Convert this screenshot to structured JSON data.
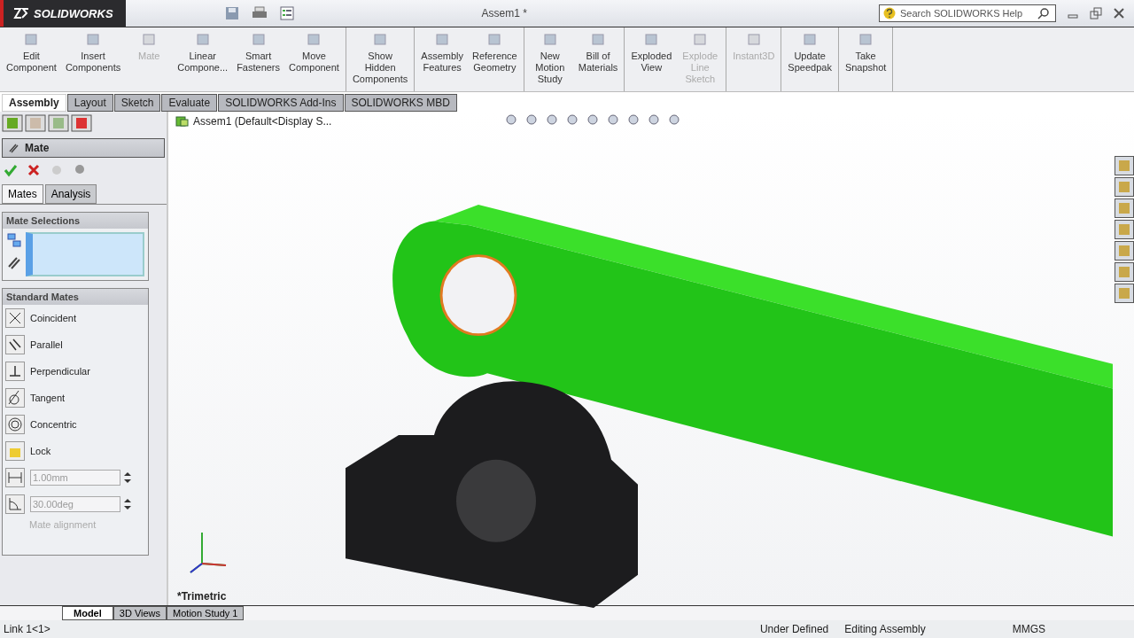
{
  "app": {
    "logo": "SOLIDWORKS",
    "title": "Assem1 *",
    "search_placeholder": "Search SOLIDWORKS Help"
  },
  "ribbon": [
    [
      {
        "label": "Edit\nComponent",
        "disabled": false
      },
      {
        "label": "Insert\nComponents",
        "disabled": false
      },
      {
        "label": "Mate",
        "disabled": true
      },
      {
        "label": "Linear\nCompone...",
        "disabled": false
      },
      {
        "label": "Smart\nFasteners",
        "disabled": false
      },
      {
        "label": "Move\nComponent",
        "disabled": false
      }
    ],
    [
      {
        "label": "Show\nHidden\nComponents",
        "disabled": false
      }
    ],
    [
      {
        "label": "Assembly\nFeatures",
        "disabled": false
      },
      {
        "label": "Reference\nGeometry",
        "disabled": false
      }
    ],
    [
      {
        "label": "New\nMotion\nStudy",
        "disabled": false
      },
      {
        "label": "Bill of\nMaterials",
        "disabled": false
      }
    ],
    [
      {
        "label": "Exploded\nView",
        "disabled": false
      },
      {
        "label": "Explode\nLine\nSketch",
        "disabled": true
      }
    ],
    [
      {
        "label": "Instant3D",
        "disabled": true
      }
    ],
    [
      {
        "label": "Update\nSpeedpak",
        "disabled": false
      }
    ],
    [
      {
        "label": "Take\nSnapshot",
        "disabled": false
      }
    ]
  ],
  "tabs": [
    {
      "label": "Assembly",
      "selected": true
    },
    {
      "label": "Layout",
      "selected": false
    },
    {
      "label": "Sketch",
      "selected": false
    },
    {
      "label": "Evaluate",
      "selected": false
    },
    {
      "label": "SOLIDWORKS Add-Ins",
      "selected": false
    },
    {
      "label": "SOLIDWORKS MBD",
      "selected": false
    }
  ],
  "tree": {
    "root": "Assem1  (Default<Display S..."
  },
  "panel": {
    "title": "Mate",
    "subtabs": [
      {
        "label": "Mates",
        "selected": true
      },
      {
        "label": "Analysis",
        "selected": false
      }
    ],
    "selections_title": "Mate Selections",
    "standard_title": "Standard Mates",
    "mates": [
      {
        "kind": "coincident",
        "label": "Coincident"
      },
      {
        "kind": "parallel",
        "label": "Parallel"
      },
      {
        "kind": "perpendicular",
        "label": "Perpendicular"
      },
      {
        "kind": "tangent",
        "label": "Tangent"
      },
      {
        "kind": "concentric",
        "label": "Concentric"
      },
      {
        "kind": "lock",
        "label": "Lock"
      }
    ],
    "fields": [
      {
        "kind": "distance",
        "value": "1.00mm",
        "disabled": true
      },
      {
        "kind": "angle",
        "value": "30.00deg",
        "disabled": true
      }
    ],
    "alignment_label": "Mate alignment"
  },
  "viewport": {
    "view_name": "*Trimetric"
  },
  "bottom_tabs": [
    {
      "label": "Model",
      "selected": true
    },
    {
      "label": "3D Views",
      "selected": false
    },
    {
      "label": "Motion Study 1",
      "selected": false
    }
  ],
  "status_bar": {
    "selection": "Link 1<1>",
    "state": "Under Defined",
    "mode": "Editing Assembly",
    "units": "MMGS"
  }
}
